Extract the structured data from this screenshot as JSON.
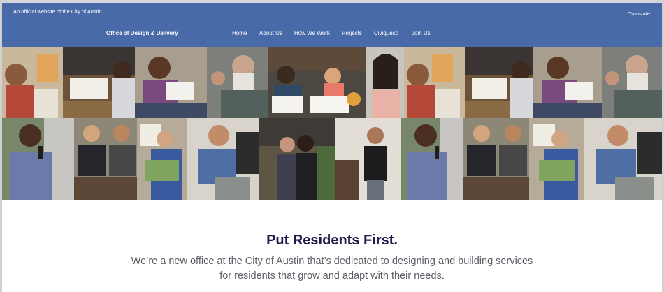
{
  "header": {
    "official_text": "An official website of the City of Austin",
    "translate_label": "Translate",
    "brand": "Office of Design & Delivery",
    "nav": [
      "Home",
      "About Us",
      "How We Work",
      "Projects",
      "Civiqueso",
      "Join Us"
    ]
  },
  "mosaic": {
    "tiles_top": [
      "office-worker-photo",
      "sketching-photo",
      "woman-with-paper-photo",
      "bearded-man-photo",
      "drawing-at-table-photo",
      "smiling-woman-photo",
      "office-worker-photo",
      "sketching-photo",
      "woman-with-paper-photo",
      "bearded-man-photo"
    ],
    "tiles_bottom": [
      "man-with-microphone-photo",
      "team-sitting-photo",
      "woman-with-chart-photo",
      "man-laughing-photo",
      "two-women-photo",
      "man-standing-photo",
      "man-with-microphone-photo",
      "team-sitting-photo",
      "woman-with-chart-photo",
      "man-laughing-photo"
    ]
  },
  "hero": {
    "title": "Put Residents First.",
    "line1": "We’re a new office at the City of Austin that’s dedicated to designing and building services",
    "line2": "for residents that grow and adapt with their needs."
  },
  "colors": {
    "header_bg": "#486aa8",
    "title_color": "#1e1a4a",
    "body_text": "#5d5d66"
  }
}
